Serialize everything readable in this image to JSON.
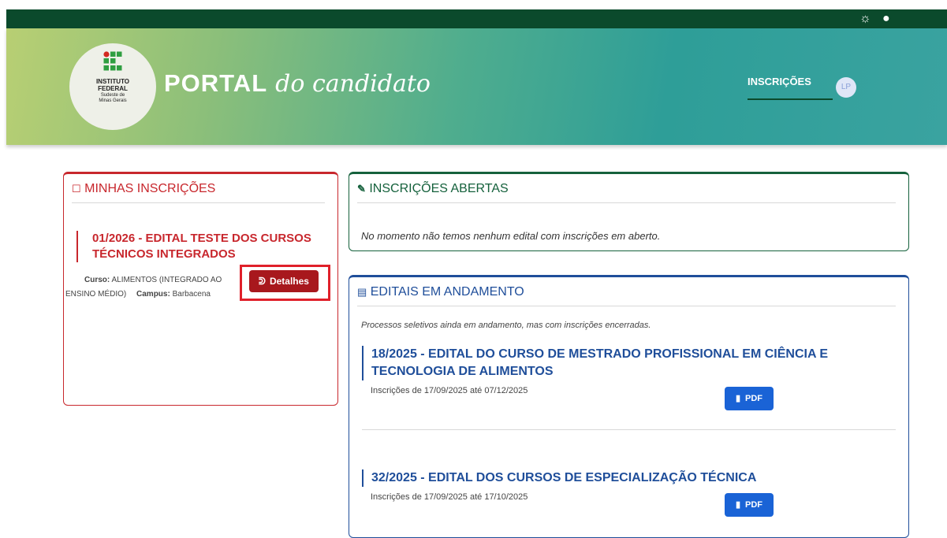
{
  "topbar": {
    "theme_icon": "sun-icon",
    "cookie_icon": "cookie-icon"
  },
  "header": {
    "logo": {
      "line1": "INSTITUTO",
      "line2": "FEDERAL",
      "line3": "Sudeste de",
      "line4": "Minas Gerais"
    },
    "title_bold": "PORTAL",
    "title_script": "do candidato",
    "nav_inscricoes": "INSCRIÇÕES",
    "avatar_initials": "LP"
  },
  "minhas": {
    "title": "MINHAS INSCRIÇÕES",
    "edital_title": "01/2026 - EDITAL TESTE DOS CURSOS TÉCNICOS INTEGRADOS",
    "curso_label": "Curso:",
    "curso_value": "ALIMENTOS (INTEGRADO AO ENSINO MÉDIO)",
    "campus_label": "Campus:",
    "campus_value": "Barbacena",
    "detalhes_label": "Detalhes"
  },
  "abertas": {
    "title": "INSCRIÇÕES ABERTAS",
    "message": "No momento não temos nenhum edital com inscrições em aberto."
  },
  "andamento": {
    "title": "EDITAIS EM ANDAMENTO",
    "subtitle": "Processos seletivos ainda em andamento, mas com inscrições encerradas.",
    "editais": [
      {
        "title": "18/2025 - EDITAL DO CURSO DE MESTRADO PROFISSIONAL EM CIÊNCIA E TECNOLOGIA DE ALIMENTOS",
        "dates": "Inscrições de 17/09/2025 até 07/12/2025",
        "pdf_label": "PDF"
      },
      {
        "title": "32/2025 - EDITAL DOS CURSOS DE ESPECIALIZAÇÃO TÉCNICA",
        "dates": "Inscrições de 17/09/2025 até 17/10/2025",
        "pdf_label": "PDF"
      }
    ]
  },
  "colors": {
    "topbar": "#0b4a2c",
    "red": "#c8272d",
    "green": "#15613c",
    "blue": "#1f4e9a",
    "pdf_button": "#1a63d6"
  }
}
